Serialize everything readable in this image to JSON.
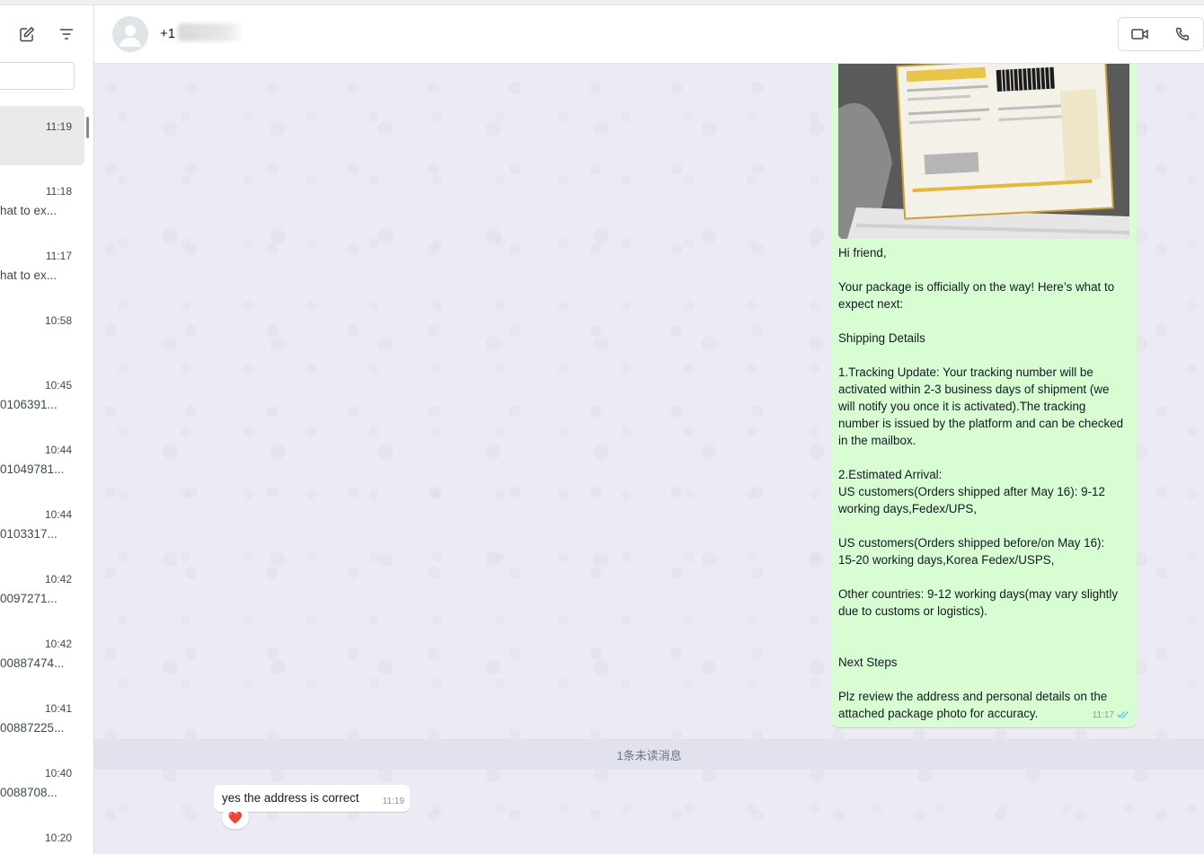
{
  "sidebar": {
    "new_chat_icon": "compose-icon",
    "filter_icon": "filter-icon",
    "chats": [
      {
        "time": "11:19",
        "preview": "",
        "selected": true
      },
      {
        "time": "11:18",
        "preview": "hat to ex..."
      },
      {
        "time": "11:17",
        "preview": "hat to ex..."
      },
      {
        "time": "10:58",
        "preview": ""
      },
      {
        "time": "10:45",
        "preview": "0106391..."
      },
      {
        "time": "10:44",
        "preview": "01049781..."
      },
      {
        "time": "10:44",
        "preview": "0103317..."
      },
      {
        "time": "10:42",
        "preview": "0097271..."
      },
      {
        "time": "10:42",
        "preview": "00887474..."
      },
      {
        "time": "10:41",
        "preview": "00887225..."
      },
      {
        "time": "10:40",
        "preview": "0088708..."
      },
      {
        "time": "10:20",
        "preview": ""
      }
    ]
  },
  "header": {
    "contact_name": "+1",
    "video_icon": "video-call-icon",
    "voice_icon": "voice-call-icon"
  },
  "messages": {
    "outgoing": {
      "image_icon": "package-label-photo",
      "lines": [
        "Hi friend,",
        "",
        "Your package is officially on the way!  Here’s what to expect next:",
        "",
        "Shipping Details",
        "",
        "1.Tracking Update: Your tracking number will be activated within 2-3 business days of shipment (we will notify you once it is activated).The tracking number is issued by the platform and can be checked in the mailbox.",
        "",
        "2.Estimated Arrival:",
        "US customers(Orders shipped after May 16): 9-12 working days,Fedex/UPS,",
        "",
        "US customers(Orders shipped before/on May 16): 15-20 working days,Korea Fedex/USPS,",
        "",
        "Other countries: 9-12 working days(may vary slightly due to customs or logistics).",
        "",
        "",
        "Next Steps",
        "",
        "Plz review the address and personal details on the attached package photo for accuracy."
      ],
      "time": "11:17",
      "status_icon": "double-check-icon"
    },
    "unread_divider": "1条未读消息",
    "incoming": {
      "text": "yes the address is correct",
      "time": "11:19",
      "reaction": "❤️"
    }
  },
  "colors": {
    "outgoing_bubble": "#d9fdd3",
    "chat_background": "#ecebf4",
    "read_tick": "#53bdeb"
  }
}
